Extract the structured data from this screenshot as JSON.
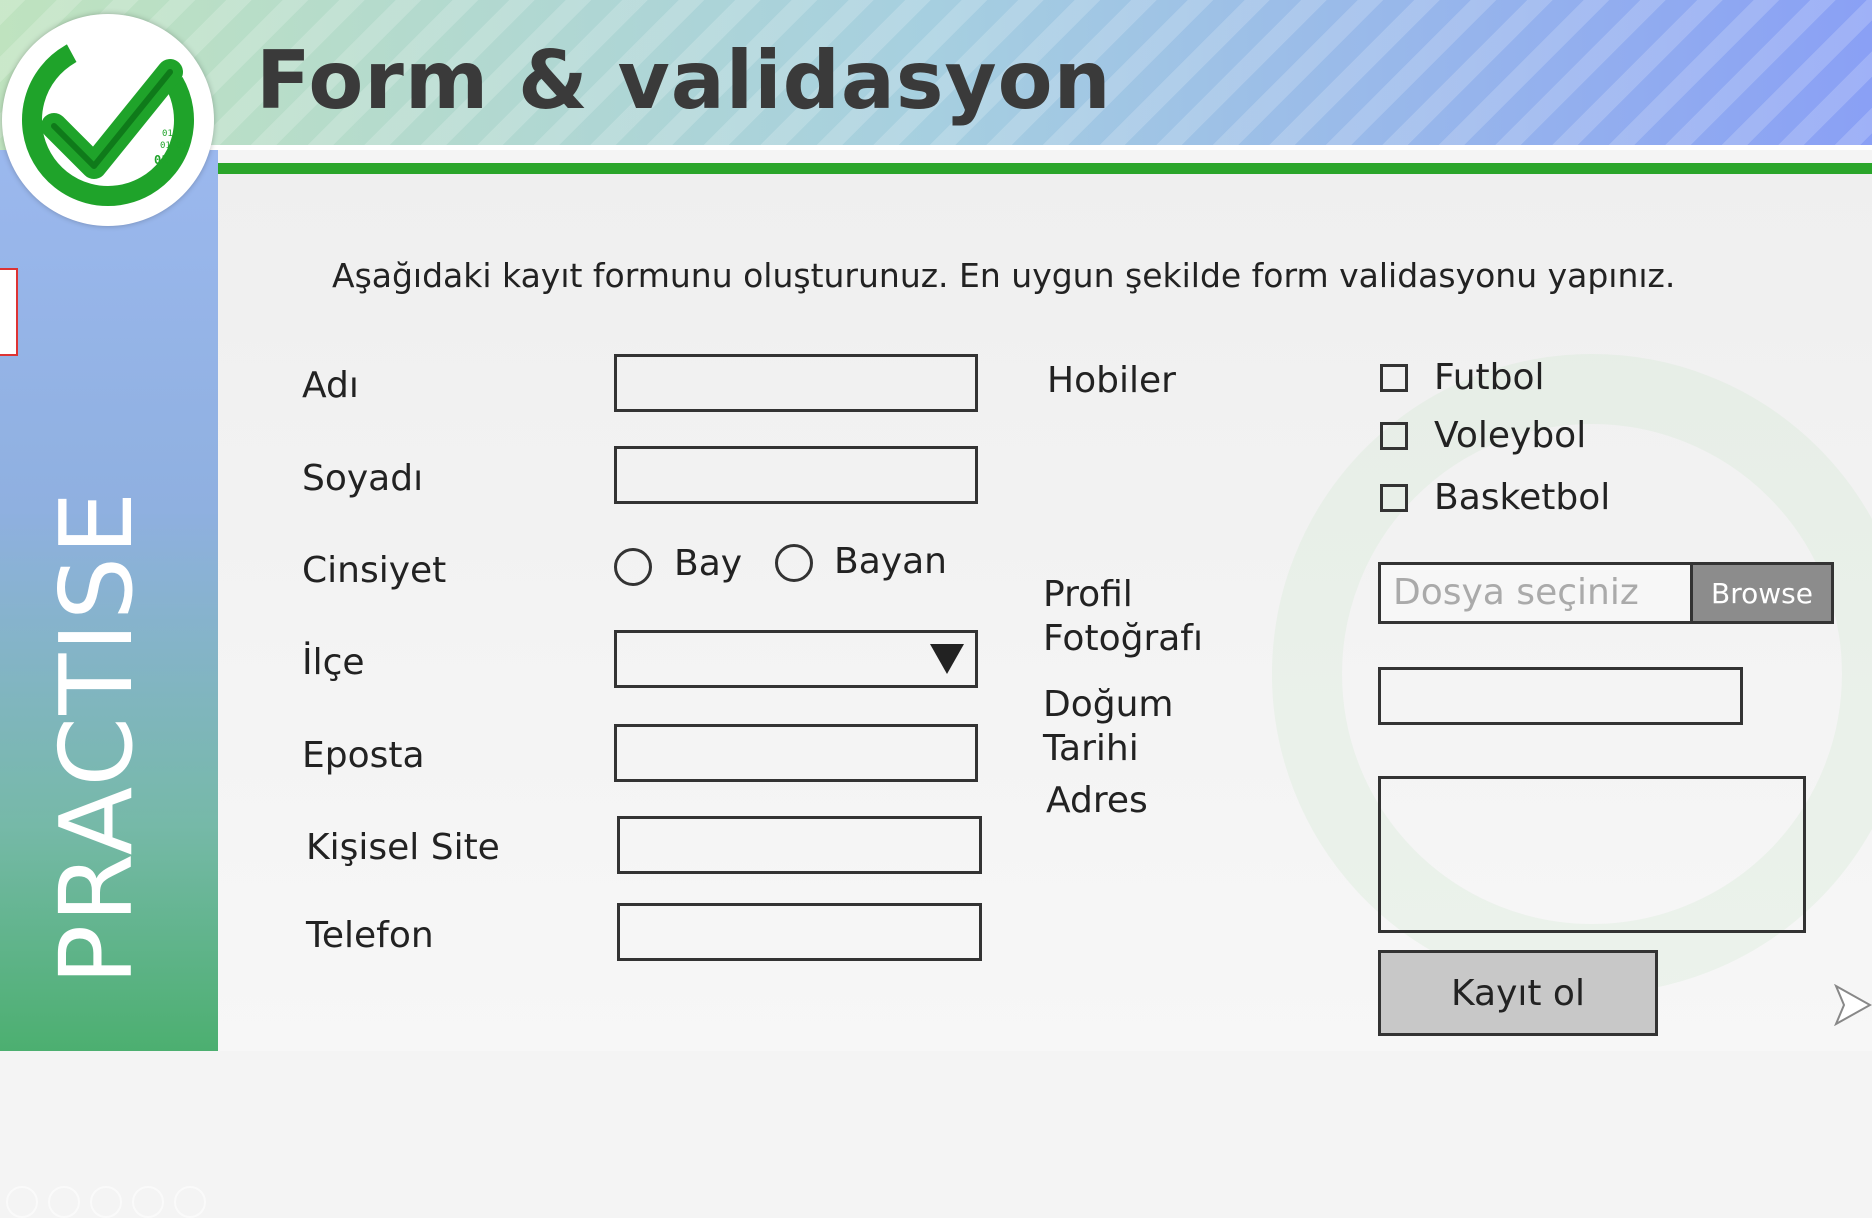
{
  "header": {
    "title": "Form & validasyon"
  },
  "sidebar": {
    "label": "PRACTISE"
  },
  "logo": {
    "icon": "checkmark-binary-logo",
    "binary_text": [
      "01",
      "01 01",
      "01"
    ]
  },
  "instruction": "Aşağıdaki kayıt formunu oluşturunuz. En uygun şekilde form validasyonu yapınız.",
  "form": {
    "left": {
      "first_name_label": "Adı",
      "last_name_label": "Soyadı",
      "gender_label": "Cinsiyet",
      "gender_options": [
        "Bay",
        "Bayan"
      ],
      "district_label": "İlçe",
      "email_label": "Eposta",
      "website_label": "Kişisel Site",
      "phone_label": "Telefon"
    },
    "right": {
      "hobbies_label": "Hobiler",
      "hobbies": [
        "Futbol",
        "Voleybol",
        "Basketbol"
      ],
      "photo_label_line1": "Profil",
      "photo_label_line2": "Fotoğrafı",
      "photo_placeholder": "Dosya seçiniz",
      "browse_label": "Browse",
      "birthdate_label_line1": "Doğum",
      "birthdate_label_line2": "Tarihi",
      "address_label": "Adres",
      "submit_label": "Kayıt ol"
    }
  },
  "colors": {
    "accent_green": "#2aa52a",
    "header_blue": "#8aa0f5"
  }
}
